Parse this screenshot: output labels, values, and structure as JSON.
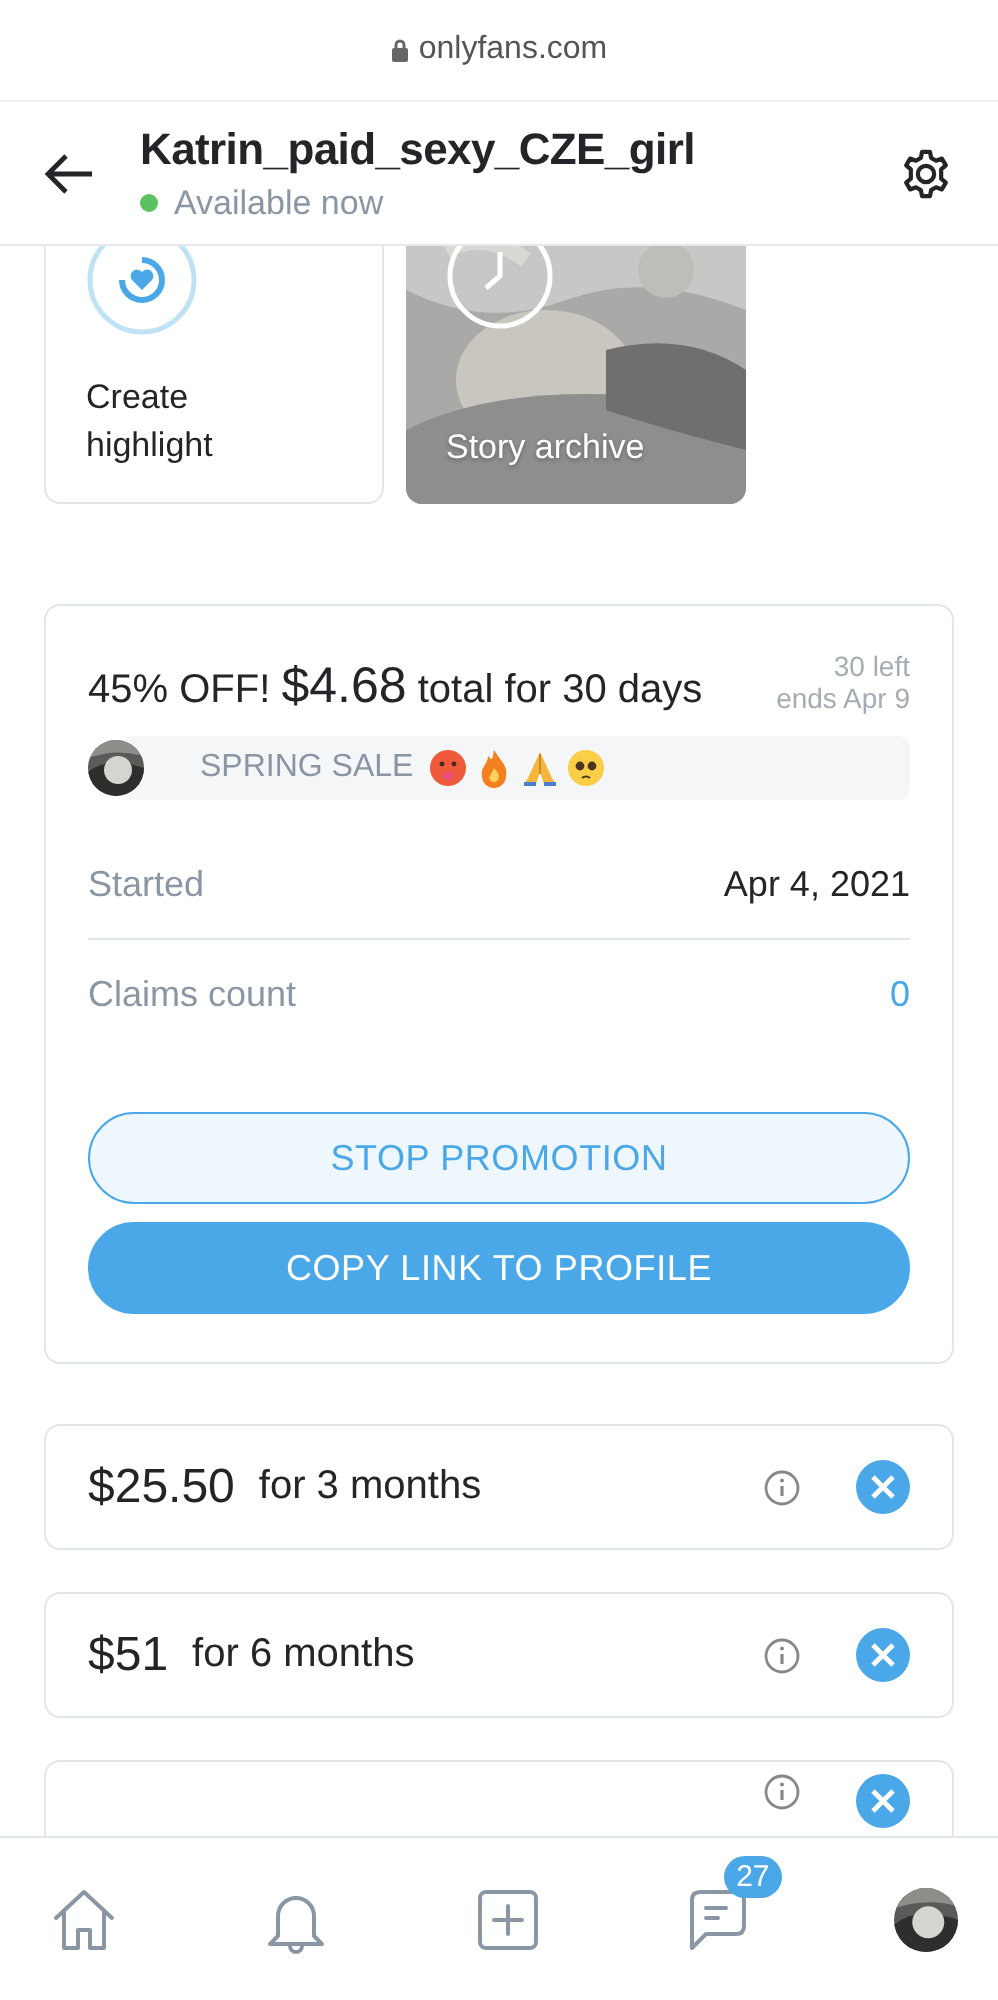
{
  "browser": {
    "address": "onlyfans.com"
  },
  "header": {
    "name": "Katrin_paid_sexy_CZE_girl",
    "status": "Available now",
    "online": true
  },
  "highlights": [
    {
      "kind": "create",
      "label": "Create highlight"
    },
    {
      "kind": "archive",
      "label": "Story archive"
    }
  ],
  "promotion": {
    "discount": "45% OFF!",
    "price": "$4.68",
    "period": "total for 30 days",
    "remaining": "30 left",
    "ends": "ends Apr 9",
    "message": "SPRING SALE",
    "rows": [
      {
        "label": "Started",
        "value": "Apr 4, 2021",
        "kind": "plain"
      },
      {
        "label": "Claims count",
        "value": "0",
        "kind": "link"
      }
    ],
    "buttons": [
      {
        "label": "STOP PROMOTION",
        "kind": "outline"
      },
      {
        "label": "COPY LINK TO PROFILE",
        "kind": "filled"
      }
    ]
  },
  "bundles": [
    {
      "kind": "full",
      "price": "$25.50",
      "period": "for 3 months"
    },
    {
      "kind": "full",
      "price": "$51",
      "period": "for 6 months"
    },
    {
      "kind": "partial"
    }
  ],
  "nav": [
    {
      "kind": "home"
    },
    {
      "kind": "bell"
    },
    {
      "kind": "add"
    },
    {
      "kind": "messages",
      "badge": "27"
    },
    {
      "kind": "avatar"
    }
  ]
}
